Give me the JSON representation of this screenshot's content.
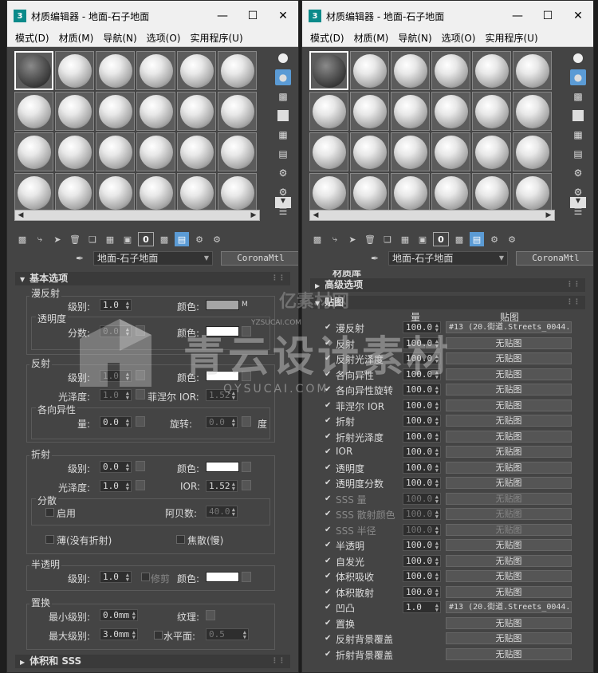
{
  "window_left": {
    "title": "材质编辑器 - 地面-石子地面",
    "app_icon": "3",
    "menu": [
      "模式(D)",
      "材质(M)",
      "导航(N)",
      "选项(O)",
      "实用程序(U)"
    ],
    "material_name": "地面-石子地面",
    "material_type": "CoronaMtl",
    "rollout_basic": "基本选项",
    "rollout_volume": "体积和 SSS",
    "diffuse": {
      "group": "漫反射",
      "level_label": "级别:",
      "level": "1.0",
      "color_label": "颜色:",
      "m_label": "M",
      "trans_group": "透明度",
      "fraction_label": "分数:",
      "fraction": "0.0",
      "trans_color_label": "颜色:"
    },
    "reflection": {
      "group": "反射",
      "level_label": "级别:",
      "level": "1.0",
      "color_label": "颜色:",
      "gloss_label": "光泽度:",
      "gloss": "1.0",
      "fresnel_label": "菲涅尔 IOR:",
      "fresnel": "1.52",
      "aniso_group": "各向异性",
      "amount_label": "量:",
      "amount": "0.0",
      "rotation_label": "旋转:",
      "rotation": "0.0",
      "degree_label": "度"
    },
    "refraction": {
      "group": "折射",
      "level_label": "级别:",
      "level": "0.0",
      "color_label": "颜色:",
      "gloss_label": "光泽度:",
      "gloss": "1.0",
      "ior_label": "IOR:",
      "ior": "1.52",
      "disp_group": "分散",
      "enable_label": "启用",
      "abbe_label": "阿贝数:",
      "abbe": "40.0",
      "thin_label": "薄(没有折射)",
      "caustics_label": "焦散(慢)"
    },
    "translucency": {
      "group": "半透明",
      "level_label": "级别:",
      "level": "1.0",
      "clip_label": "修剪",
      "color_label": "颜色:"
    },
    "displacement": {
      "group": "置换",
      "min_label": "最小级别:",
      "min": "0.0mm",
      "texture_label": "纹理:",
      "max_label": "最大级别:",
      "max": "3.0mm",
      "water_label": "水平面:",
      "water": "0.5"
    }
  },
  "window_right": {
    "title": "材质编辑器 - 地面-石子地面",
    "app_icon": "3",
    "menu": [
      "模式(D)",
      "材质(M)",
      "导航(N)",
      "选项(O)",
      "实用程序(U)"
    ],
    "material_name": "地面-石子地面",
    "material_type": "CoronaMtl",
    "partial_title": "材质库",
    "rollout_advanced": "高级选项",
    "rollout_maps": "贴图",
    "col_amount": "量",
    "col_map": "贴图",
    "maps": [
      {
        "name": "漫反射",
        "amount": "100.0",
        "map": "#13 (20.街道.Streets_0044.",
        "dim": false
      },
      {
        "name": "反射",
        "amount": "100.0",
        "map": "无贴图",
        "dim": false
      },
      {
        "name": "反射光泽度",
        "amount": "100.0",
        "map": "无贴图",
        "dim": false
      },
      {
        "name": "各向异性",
        "amount": "100.0",
        "map": "无贴图",
        "dim": false
      },
      {
        "name": "各向异性旋转",
        "amount": "100.0",
        "map": "无贴图",
        "dim": false
      },
      {
        "name": "菲涅尔 IOR",
        "amount": "100.0",
        "map": "无贴图",
        "dim": false
      },
      {
        "name": "折射",
        "amount": "100.0",
        "map": "无贴图",
        "dim": false
      },
      {
        "name": "折射光泽度",
        "amount": "100.0",
        "map": "无贴图",
        "dim": false
      },
      {
        "name": "IOR",
        "amount": "100.0",
        "map": "无贴图",
        "dim": false
      },
      {
        "name": "透明度",
        "amount": "100.0",
        "map": "无贴图",
        "dim": false
      },
      {
        "name": "透明度分数",
        "amount": "100.0",
        "map": "无贴图",
        "dim": false
      },
      {
        "name": "SSS 量",
        "amount": "100.0",
        "map": "无贴图",
        "dim": true
      },
      {
        "name": "SSS 散射颜色",
        "amount": "100.0",
        "map": "无贴图",
        "dim": true
      },
      {
        "name": "SSS 半径",
        "amount": "100.0",
        "map": "无贴图",
        "dim": true
      },
      {
        "name": "半透明",
        "amount": "100.0",
        "map": "无贴图",
        "dim": false
      },
      {
        "name": "自发光",
        "amount": "100.0",
        "map": "无贴图",
        "dim": false
      },
      {
        "name": "体积吸收",
        "amount": "100.0",
        "map": "无贴图",
        "dim": false
      },
      {
        "name": "体积散射",
        "amount": "100.0",
        "map": "无贴图",
        "dim": false
      },
      {
        "name": "凹凸",
        "amount": "1.0",
        "map": "#13 (20.街道.Streets_0044.",
        "dim": false
      },
      {
        "name": "置换",
        "amount": "",
        "map": "无贴图",
        "dim": false
      },
      {
        "name": "反射背景覆盖",
        "amount": "",
        "map": "无贴图",
        "dim": false
      },
      {
        "name": "折射背景覆盖",
        "amount": "",
        "map": "无贴图",
        "dim": false
      }
    ]
  },
  "watermark": {
    "brand_cn": "青云设计素材",
    "site": "QYSUCAI.COM",
    "badge": "亿素材网",
    "badge_sub": "YZSUCAI.COM"
  },
  "colors": {
    "accent": "#5b9bd5",
    "panel": "#444444",
    "title_bar": "#f0f0f0"
  }
}
